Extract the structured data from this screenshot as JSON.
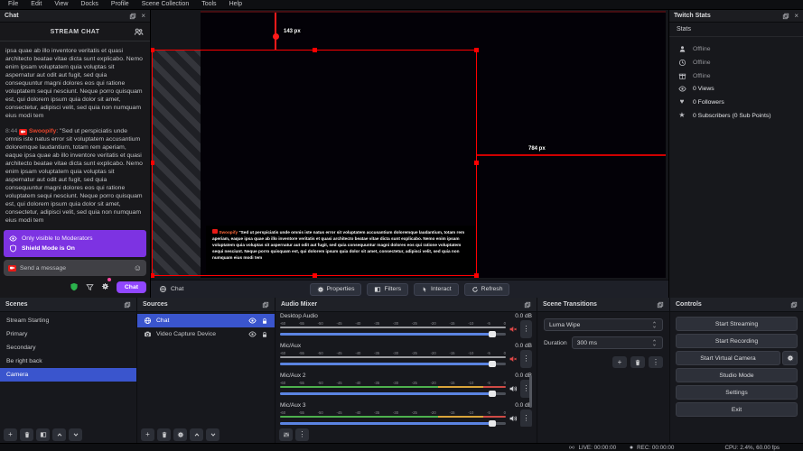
{
  "theme": {
    "accent_blue": "#3a55cd",
    "twitch_purple": "#9147ff",
    "banner_purple": "#7d33e2",
    "selection_red": "#ff0000",
    "mute_red": "#e04848",
    "username_red": "#e8452c"
  },
  "glyphs": {
    "close": "×",
    "kebab": "⋮",
    "plus": "+",
    "smiley": "☺",
    "heart": "♥",
    "star": "★"
  },
  "menu": {
    "items": [
      "File",
      "Edit",
      "View",
      "Docks",
      "Profile",
      "Scene Collection",
      "Tools",
      "Help"
    ]
  },
  "chat_dock": {
    "title": "Chat",
    "header": "STREAM CHAT",
    "message1": {
      "text": "ipsa quae ab illo inventore veritatis et quasi architecto beatae vitae dicta sunt explicabo. Nemo enim ipsam voluptatem quia voluptas sit aspernatur aut odit aut fugit, sed quia consequuntur magni dolores eos qui ratione voluptatem sequi nesciunt. Neque porro quisquam est, qui dolorem ipsum quia dolor sit amet, consectetur, adipisci velit, sed quia non numquam eius modi tem"
    },
    "message2": {
      "time": "8:44",
      "user": "Swoopify",
      "text": ": \"Sed ut perspiciatis unde omnis iste natus error sit voluptatem accusantium doloremque laudantium, totam rem aperiam, eaque ipsa quae ab illo inventore veritatis et quasi architecto beatae vitae dicta sunt explicabo. Nemo enim ipsam voluptatem quia voluptas sit aspernatur aut odit aut fugit, sed quia consequuntur magni dolores eos qui ratione voluptatem sequi nesciunt. Neque porro quisquam est, qui dolorem ipsum quia dolor sit amet, consectetur, adipisci velit, sed quia non numquam eius modi tem"
    },
    "banner": {
      "line1": "Only visible to Moderators",
      "line2": "Shield Mode is On"
    },
    "input_placeholder": "Send a message",
    "chat_button": "Chat"
  },
  "preview": {
    "guide_vertical": "143 px",
    "guide_horizontal": "784 px",
    "overlay": {
      "user": "Swoopify",
      "text": " \"Sed ut perspiciatis unde omnis iste natus error sit voluptatem accusantium doloremque laudantium, totam rem aperiam, eaque ipsa quae ab illo inventore veritatis et quasi architecto beatae vitae dicta sunt explicabo. Nemo enim ipsam voluptatem quia voluptas sit aspernatur aut odit aut fugit, sed quia consequuntur magni dolores eos qui ratione voluptatem sequi nesciunt. Neque porro quisquam est, qui dolorem ipsum quia dolor sit amet, consectetur, adipisci velit, sed quia non numquam eius modi tem"
    }
  },
  "context_bar": {
    "source": "Chat",
    "buttons": [
      "Properties",
      "Filters",
      "Interact",
      "Refresh"
    ]
  },
  "twitch_stats": {
    "title": "Twitch Stats",
    "subtitle": "Stats",
    "rows": [
      {
        "icon": "person-icon",
        "text": "Offline"
      },
      {
        "icon": "clock-icon",
        "text": "Offline"
      },
      {
        "icon": "gift-icon",
        "text": "Offline"
      },
      {
        "icon": "eye-icon",
        "text": "0 Views"
      },
      {
        "icon": "heart-icon",
        "text": "0 Followers"
      },
      {
        "icon": "star-icon",
        "text": "0 Subscribers (0 Sub Points)"
      }
    ]
  },
  "scenes": {
    "title": "Scenes",
    "items": [
      "Stream Starting",
      "Primary",
      "Secondary",
      "Be right back",
      "Camera"
    ],
    "selected": "Camera"
  },
  "sources": {
    "title": "Sources",
    "items": [
      {
        "name": "Chat",
        "icon": "globe-icon"
      },
      {
        "name": "Video Capture Device",
        "icon": "camera-icon"
      }
    ],
    "selected": "Chat"
  },
  "audio_mixer": {
    "title": "Audio Mixer",
    "ticks": [
      "-60",
      "-55",
      "-50",
      "-45",
      "-40",
      "-35",
      "-30",
      "-25",
      "-20",
      "-15",
      "-10",
      "-5",
      "0"
    ],
    "channels": [
      {
        "name": "Desktop Audio",
        "db": "0.0 dB",
        "muted": true
      },
      {
        "name": "Mic/Aux",
        "db": "0.0 dB",
        "muted": true
      },
      {
        "name": "Mic/Aux 2",
        "db": "0.0 dB",
        "muted": false
      },
      {
        "name": "Mic/Aux 3",
        "db": "0.0 dB",
        "muted": false
      }
    ]
  },
  "transitions": {
    "title": "Scene Transitions",
    "transition": "Luma Wipe",
    "duration_label": "Duration",
    "duration_value": "300 ms"
  },
  "controls": {
    "title": "Controls",
    "buttons": [
      "Start Streaming",
      "Start Recording",
      "Start Virtual Camera",
      "Studio Mode",
      "Settings",
      "Exit"
    ]
  },
  "status_bar": {
    "live": "LIVE: 00:00:00",
    "rec": "REC: 00:00:00",
    "cpu": "CPU: 2.4%, 60.00 fps"
  }
}
